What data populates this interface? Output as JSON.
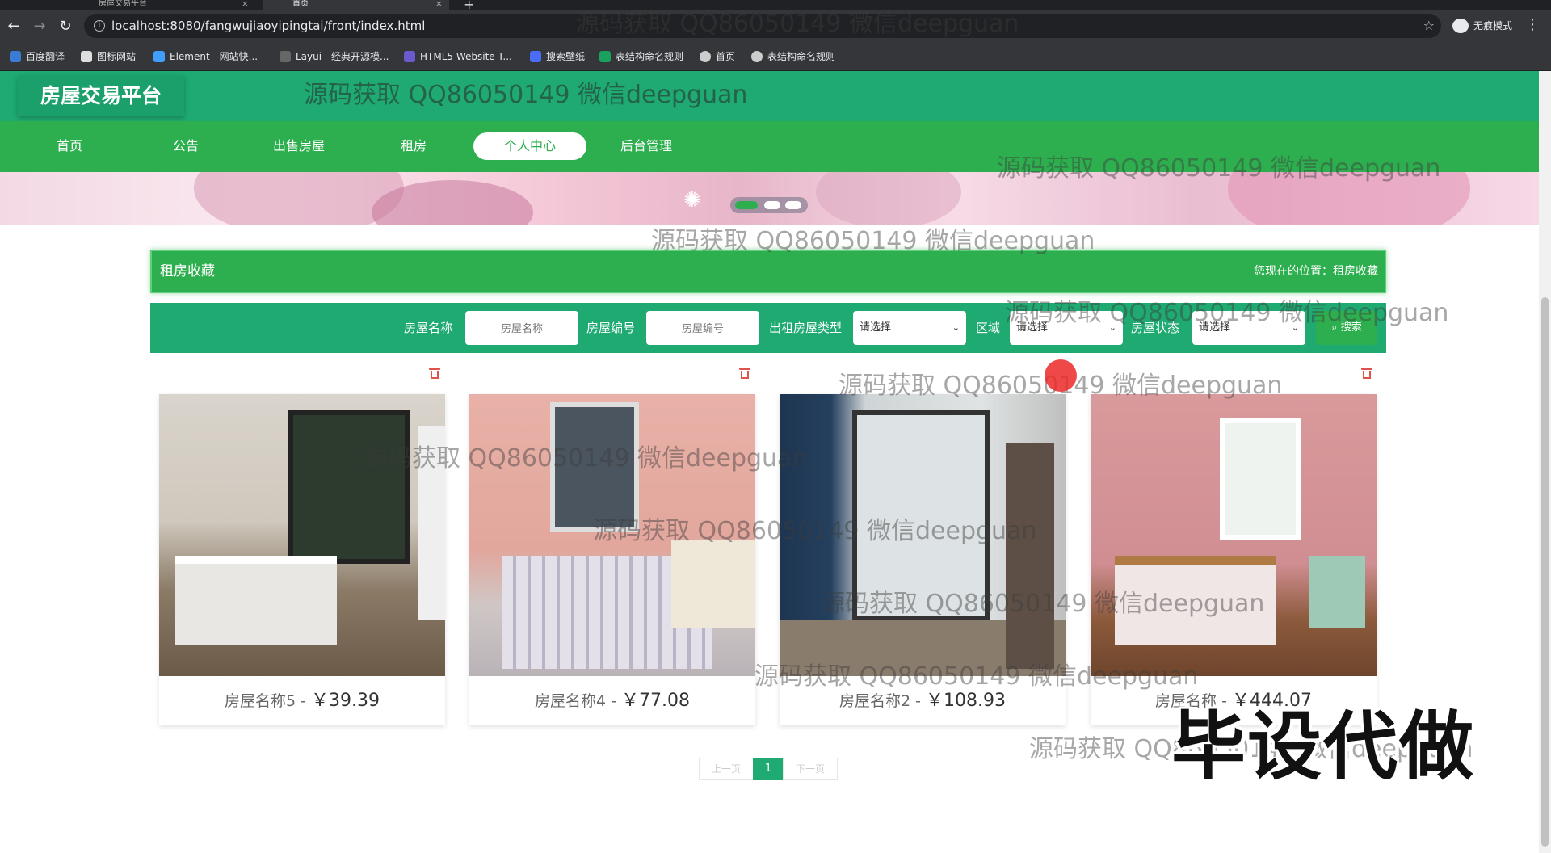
{
  "browser": {
    "tabs": [
      {
        "title": "房屋交易平台",
        "active": false
      },
      {
        "title": "首页",
        "active": true
      }
    ],
    "url": "localhost:8080/fangwujiaoyipingtai/front/index.html",
    "incognito_label": "无痕模式",
    "bookmarks": [
      "百度翻译",
      "图标网站",
      "Element - 网站快...",
      "Layui - 经典开源模...",
      "HTML5 Website T...",
      "搜索壁纸",
      "表结构命名规则",
      "首页",
      "表结构命名规则"
    ]
  },
  "site": {
    "logo": "房屋交易平台",
    "nav": [
      "首页",
      "公告",
      "出售房屋",
      "租房",
      "个人中心",
      "后台管理"
    ],
    "nav_active_index": 4,
    "accent_color": "#2eaf4f",
    "header_color": "#1faa72"
  },
  "page": {
    "title": "租房收藏",
    "location_label": "您现在的位置：",
    "location_value": "租房收藏"
  },
  "search": {
    "fields": [
      {
        "label": "房屋名称",
        "placeholder": "房屋名称",
        "type": "input"
      },
      {
        "label": "房屋编号",
        "placeholder": "房屋编号",
        "type": "input"
      },
      {
        "label": "出租房屋类型",
        "value": "请选择",
        "type": "select"
      },
      {
        "label": "区域",
        "value": "请选择",
        "type": "select"
      },
      {
        "label": "房屋状态",
        "value": "请选择",
        "type": "select"
      }
    ],
    "button_label": "搜索"
  },
  "cards": [
    {
      "name": "房屋名称5",
      "sep": " - ",
      "price": "￥39.39",
      "delete_icon": "trash-icon"
    },
    {
      "name": "房屋名称4",
      "sep": " - ",
      "price": "￥77.08",
      "delete_icon": "trash-icon"
    },
    {
      "name": "房屋名称2",
      "sep": " - ",
      "price": "￥108.93",
      "delete_icon": "trash-icon"
    },
    {
      "name": "房屋名称",
      "sep": " - ",
      "price": "￥444.07",
      "delete_icon": "trash-icon"
    }
  ],
  "pagination": {
    "prev": "上一页",
    "current": "1",
    "next": "下一页"
  },
  "watermarks": {
    "text": "源码获取 QQ86050149 微信deepguan",
    "stamp": "毕设代做"
  },
  "carousel": {
    "slides": 3,
    "active": 0
  }
}
